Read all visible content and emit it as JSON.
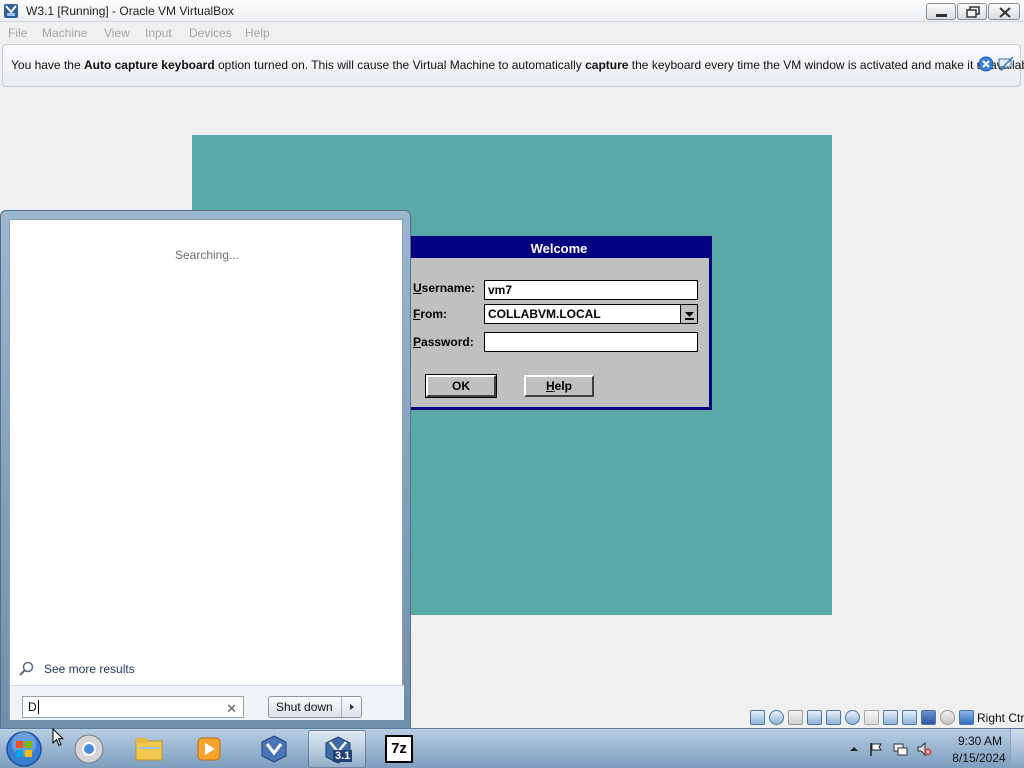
{
  "window": {
    "title": "W3.1 [Running] - Oracle VM VirtualBox"
  },
  "menu": {
    "items": [
      "File",
      "Machine",
      "View",
      "Input",
      "Devices",
      "Help"
    ]
  },
  "notice": {
    "part1": "You have the ",
    "bold1": "Auto capture keyboard",
    "part2": " option turned on. This will cause the Virtual Machine to automatically ",
    "bold2": "capture",
    "part3": " the keyboard every time the VM window is activated and make it unavailable to"
  },
  "guest": {
    "dialog_title": "Welcome",
    "username_label": "sername:",
    "username_accel": "U",
    "username_value": "vm7",
    "from_label": "rom:",
    "from_accel": "F",
    "from_value": "COLLABVM.LOCAL",
    "password_label": "assword:",
    "password_accel": "P",
    "password_value": "",
    "ok_label": "OK",
    "help_label": "elp",
    "help_accel": "H",
    "colors": {
      "desktop": "#5aa9a9",
      "titlebar": "#000080",
      "face": "#c0c0c0"
    }
  },
  "start_menu": {
    "status": "Searching...",
    "see_more": "See more results",
    "search_value": "D",
    "shutdown_label": "Shut down"
  },
  "vbox_status": {
    "host_key": "Right Ctrl",
    "icons": [
      "hdd-icon",
      "optical-icon",
      "floppy-icon",
      "audio-icon",
      "network-icon",
      "usb-icon",
      "shared-folder-icon",
      "display-icon",
      "video-capture-icon",
      "vm-icon",
      "mouse-icon",
      "host-key-icon"
    ]
  },
  "taskbar": {
    "apps": [
      "chrome-icon",
      "explorer-icon",
      "media-player-icon",
      "virtualbox-icon",
      "vm-w31-icon",
      "7zip-icon"
    ],
    "active_app_label": "3.1",
    "sevenzip_label": "7z",
    "time": "9:30 AM",
    "date": "8/15/2024"
  }
}
